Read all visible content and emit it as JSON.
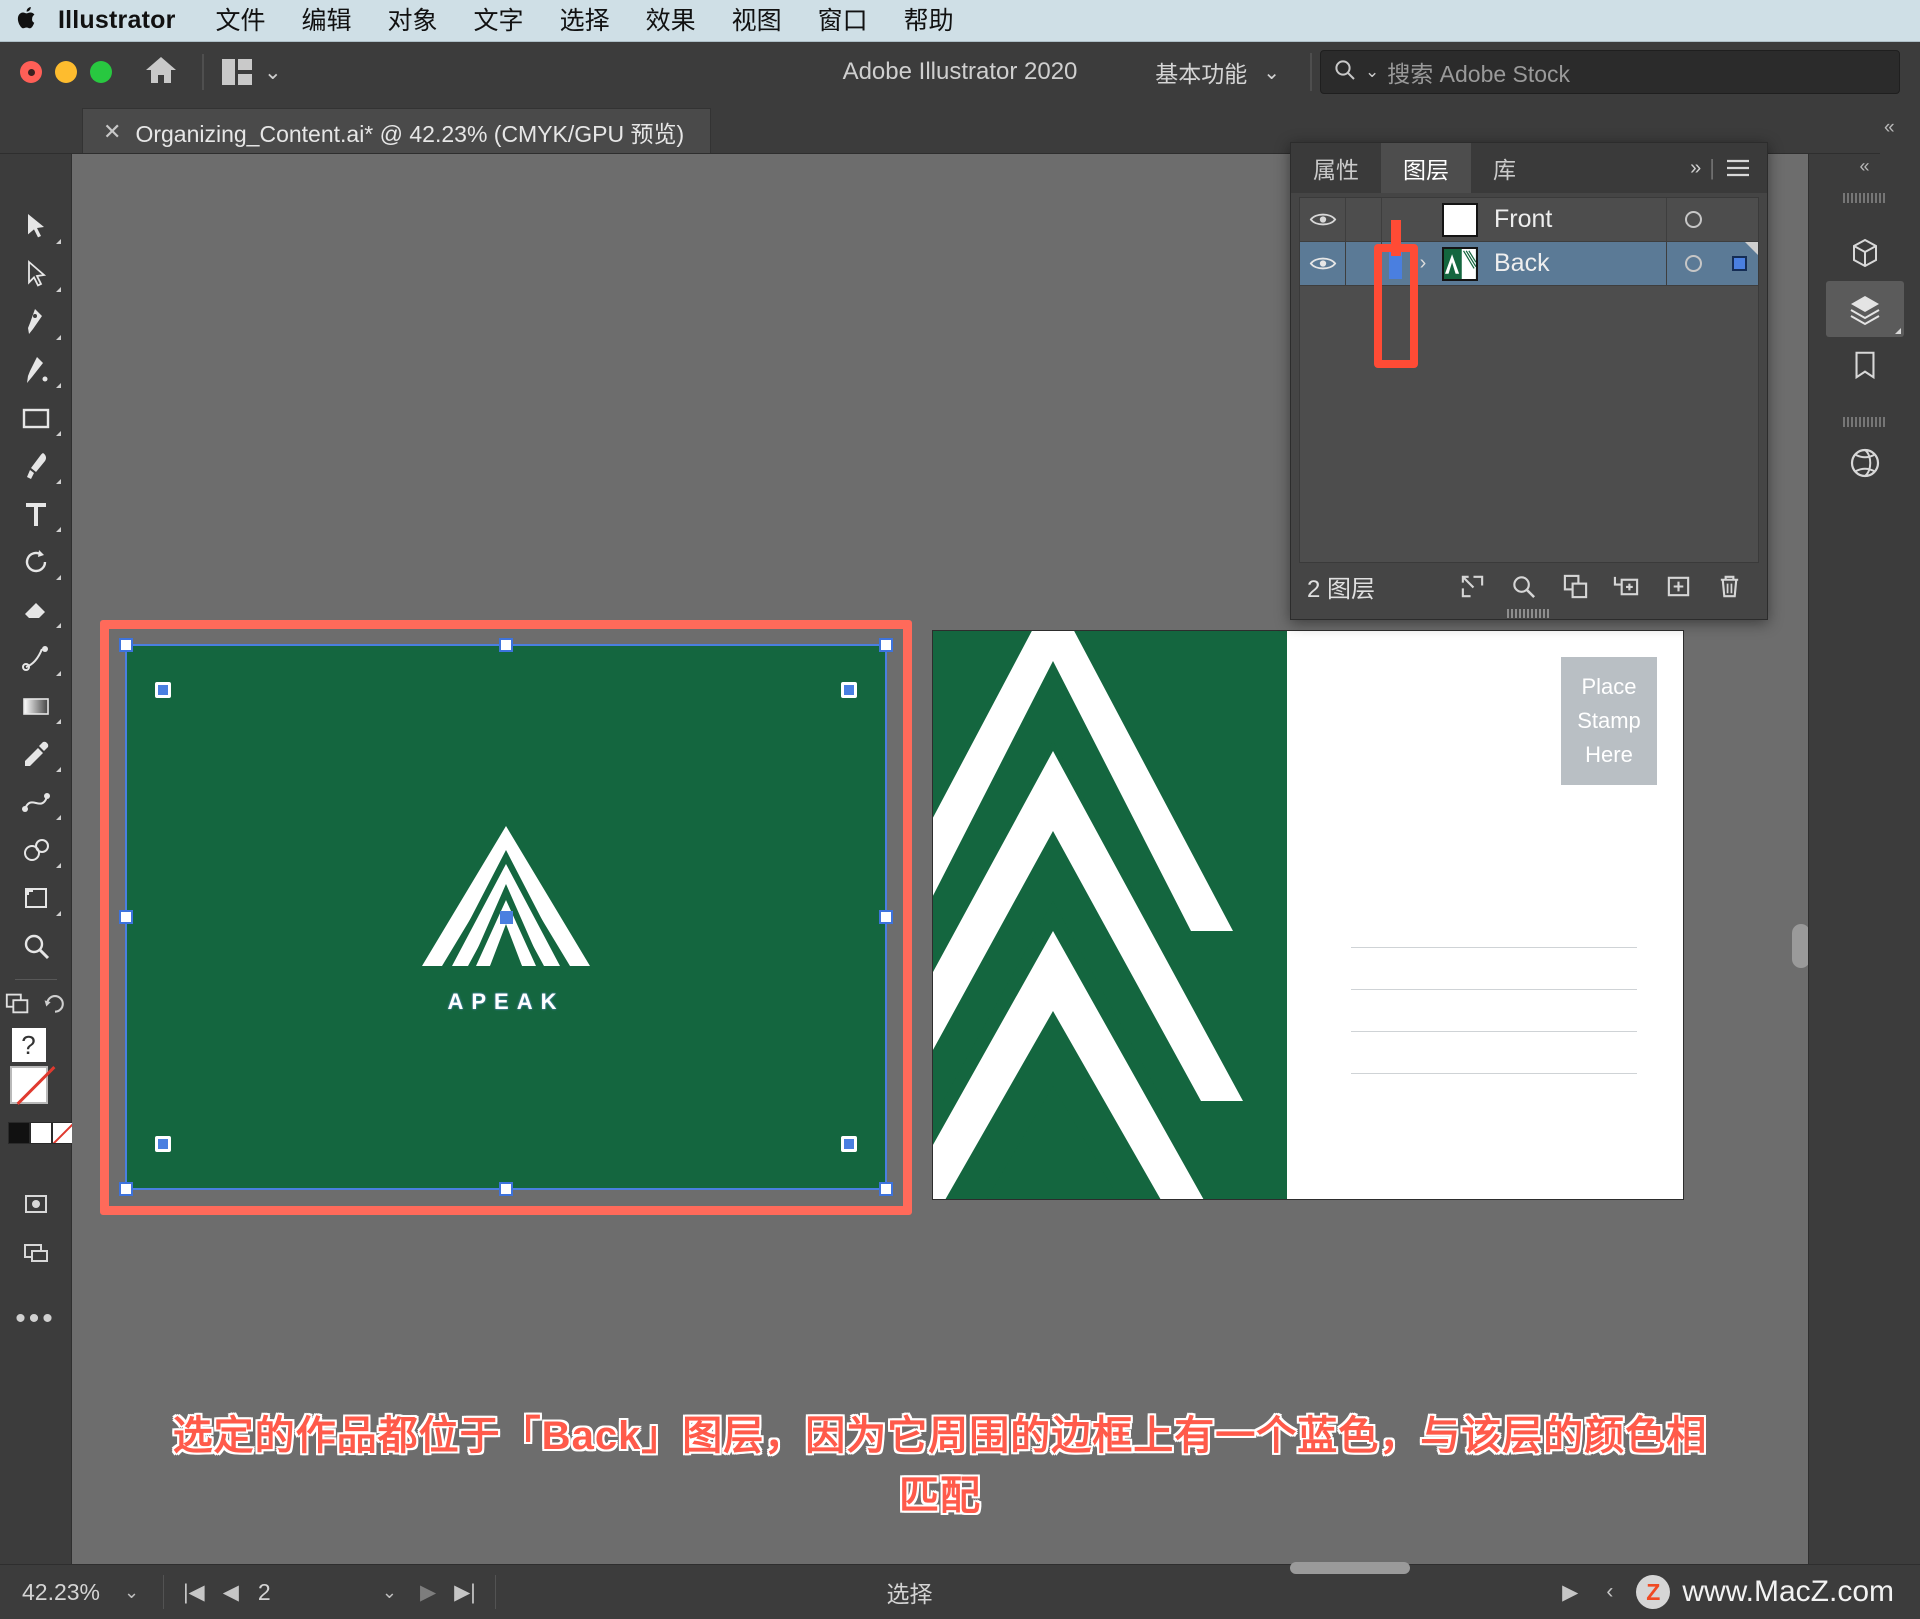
{
  "menubar": {
    "apple_icon": "apple-icon",
    "app_name": "Illustrator",
    "items": [
      "文件",
      "编辑",
      "对象",
      "文字",
      "选择",
      "效果",
      "视图",
      "窗口",
      "帮助"
    ]
  },
  "titlebar": {
    "document_title": "Adobe Illustrator 2020",
    "home_icon": "home-icon",
    "arrange_icon": "arrange-documents-icon",
    "workspace": "基本功能",
    "workspace_chevron": "chevron-down-icon",
    "search_icon": "search-icon",
    "search_placeholder": "搜索 Adobe Stock",
    "search_value": ""
  },
  "tabs": {
    "close_icon": "close-icon",
    "active_tab": "Organizing_Content.ai* @ 42.23% (CMYK/GPU 预览)",
    "left_chevron": "expand-panel-icon",
    "right_chevron": "collapse-panel-icon"
  },
  "toolbar": {
    "tools": [
      {
        "name": "selection-tool",
        "label": "选择工具"
      },
      {
        "name": "direct-selection-tool",
        "label": "直接选择工具"
      },
      {
        "name": "pen-tool",
        "label": "钢笔工具"
      },
      {
        "name": "curvature-tool",
        "label": "曲率工具"
      },
      {
        "name": "rectangle-tool",
        "label": "矩形工具"
      },
      {
        "name": "paintbrush-tool",
        "label": "画笔工具"
      },
      {
        "name": "type-tool",
        "label": "文字工具"
      },
      {
        "name": "rotate-tool",
        "label": "旋转工具"
      },
      {
        "name": "eraser-tool",
        "label": "橡皮擦工具"
      },
      {
        "name": "scale-tool",
        "label": "比例缩放工具"
      },
      {
        "name": "gradient-tool",
        "label": "渐变工具"
      },
      {
        "name": "eyedropper-tool",
        "label": "吸管工具"
      },
      {
        "name": "blend-tool",
        "label": "混合工具"
      },
      {
        "name": "shape-builder-tool",
        "label": "形状生成器工具"
      },
      {
        "name": "artboard-tool",
        "label": "画板工具"
      },
      {
        "name": "zoom-tool",
        "label": "缩放工具"
      }
    ],
    "fill_color": "#ffffff",
    "stroke_color": "#ffffff",
    "more_tools_icon": "more-tools-icon",
    "more_tools_label": "•••"
  },
  "layers_panel": {
    "tabs": [
      {
        "label": "属性",
        "active": false
      },
      {
        "label": "图层",
        "active": true
      },
      {
        "label": "库",
        "active": false
      }
    ],
    "expand_icon": "double-chevron-icon",
    "menu_icon": "panel-menu-icon",
    "layers": [
      {
        "name": "Front",
        "visible": true,
        "visibility_icon": "eye-icon",
        "selected": false,
        "color": "#4a7fe0",
        "thumbnail": "white",
        "target_icon": "target-circle-icon",
        "has_selection_square": false
      },
      {
        "name": "Back",
        "visible": true,
        "visibility_icon": "eye-icon",
        "selected": true,
        "color": "#4a7fe0",
        "thumbnail": "green-artwork",
        "disclosure_icon": "chevron-right-icon",
        "target_icon": "target-circle-icon",
        "has_selection_square": true,
        "selection_color": "#4a7fe0"
      }
    ],
    "footer": {
      "count_label": "2 图层",
      "buttons": [
        {
          "name": "release-to-layers-icon",
          "label": "收集以导出"
        },
        {
          "name": "locate-object-icon",
          "label": "定位对象"
        },
        {
          "name": "duplicate-layer-icon",
          "label": "创建新子图层"
        },
        {
          "name": "make-sublayer-icon",
          "label": "建立/释放剪切蒙版"
        },
        {
          "name": "new-layer-icon",
          "label": "创建新图层"
        },
        {
          "name": "delete-layer-icon",
          "label": "删除所选图层"
        }
      ]
    }
  },
  "right_dock": {
    "collapse_icon": "double-chevron-left-icon",
    "buttons": [
      {
        "name": "properties-panel-icon",
        "active": false
      },
      {
        "name": "layers-panel-icon",
        "active": true
      },
      {
        "name": "libraries-panel-icon",
        "active": false
      },
      {
        "name": "color-wheel-panel-icon",
        "active": false
      }
    ]
  },
  "canvas": {
    "artboard_front": {
      "background_color": "#14663f",
      "logo_name": "apeak-triangle-logo",
      "brand_text": "APEAK",
      "selected": true,
      "selection_color": "#4a7fe0",
      "highlight_color": "#ff6a5a"
    },
    "artboard_back": {
      "background_color": "#ffffff",
      "accent_color": "#14663f",
      "stamp_lines": [
        "Place",
        "Stamp",
        "Here"
      ],
      "stamp_bg": "#b9bfc4",
      "address_line_count": 4
    }
  },
  "annotation": {
    "line1": "选定的作品都位于「Back」图层，因为它周围的边框上有一个蓝色，与该层的颜色相",
    "line2": "匹配",
    "color": "#ff5a4a"
  },
  "statusbar": {
    "zoom_level": "42.23%",
    "zoom_chevron": "chevron-down-icon",
    "first_artboard_icon": "first-artboard-icon",
    "prev_artboard_icon": "prev-artboard-icon",
    "artboard_number": "2",
    "artboard_chevron": "chevron-down-icon",
    "next_artboard_icon": "next-artboard-icon",
    "last_artboard_icon": "last-artboard-icon",
    "status_label": "选择",
    "play_icon": "play-icon",
    "left_chevron_icon": "chevron-left-icon"
  },
  "watermark": {
    "badge": "Z",
    "text": "www.MacZ.com"
  }
}
